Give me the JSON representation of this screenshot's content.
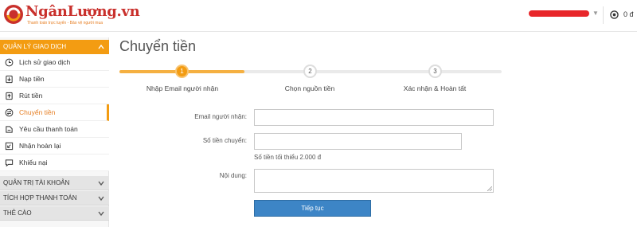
{
  "header": {
    "brand": "NgânLượng.vn",
    "tagline": "Thanh toán trực tuyến - Bảo vệ người mua",
    "balance": "0 đ"
  },
  "sidebar": {
    "sections": [
      {
        "label": "QUẢN LÝ GIAO DỊCH",
        "expanded": true
      },
      {
        "label": "QUẢN TRỊ TÀI KHOẢN",
        "expanded": false
      },
      {
        "label": "TÍCH HỢP THANH TOÁN",
        "expanded": false
      },
      {
        "label": "THẺ CÀO",
        "expanded": false
      }
    ],
    "items": [
      {
        "label": "Lịch sử giao dịch",
        "icon": "history-icon"
      },
      {
        "label": "Nạp tiền",
        "icon": "deposit-icon"
      },
      {
        "label": "Rút tiền",
        "icon": "withdraw-icon"
      },
      {
        "label": "Chuyển tiền",
        "icon": "transfer-icon",
        "active": true
      },
      {
        "label": "Yêu cầu thanh toán",
        "icon": "payment-request-icon"
      },
      {
        "label": "Nhận hoàn lại",
        "icon": "refund-icon"
      },
      {
        "label": "Khiếu nại",
        "icon": "complaint-icon"
      }
    ]
  },
  "main": {
    "title": "Chuyển tiền",
    "steps": [
      {
        "number": "1",
        "label": "Nhập Email người nhận",
        "active": true
      },
      {
        "number": "2",
        "label": "Chọn nguồn tiền",
        "active": false
      },
      {
        "number": "3",
        "label": "Xác nhận & Hoàn tất",
        "active": false
      }
    ],
    "form": {
      "email_label": "Email người nhận:",
      "email_value": "",
      "amount_label": "Số tiền chuyển:",
      "amount_value": "",
      "amount_hint": "Số tiền tối thiểu 2.000 đ",
      "content_label": "Nội dung:",
      "content_value": "",
      "submit_label": "Tiếp tục"
    }
  },
  "colors": {
    "accent": "#f39c12",
    "brand_red": "#c9302c",
    "button_blue": "#3d85c6"
  }
}
